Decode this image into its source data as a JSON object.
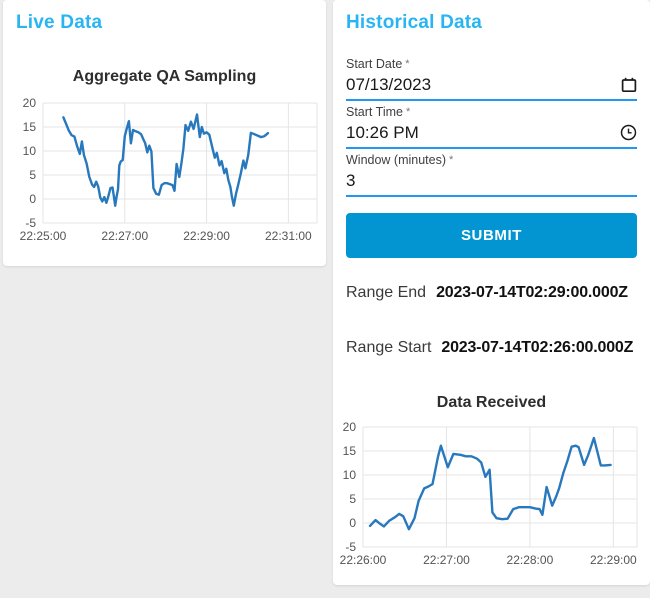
{
  "colors": {
    "header_blue": "#29b5f2",
    "underline_blue": "#2196f3",
    "submit_blue": "#0295d2",
    "page_background": "#ececec"
  },
  "live_panel": {
    "title": "Live Data"
  },
  "historical_panel": {
    "title": "Historical Data",
    "fields": [
      {
        "label": "Start Date",
        "required_marker": "*",
        "value": "07/13/2023",
        "icon": "calendar-icon"
      },
      {
        "label": "Start Time",
        "required_marker": "*",
        "value": "10:26 PM",
        "icon": "clock-icon"
      },
      {
        "label": "Window (minutes)",
        "required_marker": "*",
        "value": "3",
        "icon": ""
      }
    ],
    "submit_label": "SUBMIT",
    "range_end": {
      "label": "Range End",
      "value": "2023-07-14T02:29:00.000Z"
    },
    "range_start": {
      "label": "Range Start",
      "value": "2023-07-14T02:26:00.000Z"
    }
  },
  "chart_data": [
    {
      "type": "line",
      "title": "Aggregate QA Sampling",
      "xlabel": "",
      "ylabel": "",
      "x_unit": "seconds after 22:25:00",
      "x_domain": [
        0,
        402
      ],
      "x_ticks": [
        {
          "v": 0,
          "label": "22:25:00"
        },
        {
          "v": 120,
          "label": "22:27:00"
        },
        {
          "v": 240,
          "label": "22:29:00"
        },
        {
          "v": 360,
          "label": "22:31:00"
        }
      ],
      "y_domain": [
        -5,
        20
      ],
      "y_ticks": [
        -5,
        0,
        5,
        10,
        15,
        20
      ],
      "grid": true,
      "legend": "none",
      "line_color": "#2878bd",
      "grid_color": "#e4e4e4",
      "tick_color": "#545454",
      "points": [
        [
          30,
          17
        ],
        [
          34,
          15.6
        ],
        [
          38,
          14.2
        ],
        [
          42,
          13.3
        ],
        [
          46,
          13
        ],
        [
          50,
          11
        ],
        [
          54,
          9.4
        ],
        [
          57,
          12
        ],
        [
          60,
          9.2
        ],
        [
          64,
          7.4
        ],
        [
          68,
          4.6
        ],
        [
          72,
          3
        ],
        [
          75,
          2.5
        ],
        [
          78,
          3.6
        ],
        [
          81,
          2.6
        ],
        [
          84,
          0.3
        ],
        [
          87,
          -0.5
        ],
        [
          90,
          0.4
        ],
        [
          93,
          -0.8
        ],
        [
          96,
          0.6
        ],
        [
          99,
          2.3
        ],
        [
          102,
          2.4
        ],
        [
          104,
          0.5
        ],
        [
          106,
          -1.4
        ],
        [
          108,
          0.5
        ],
        [
          110,
          2
        ],
        [
          112,
          7
        ],
        [
          114,
          7.8
        ],
        [
          117,
          8.1
        ],
        [
          120,
          13.1
        ],
        [
          123,
          14.7
        ],
        [
          126,
          16.2
        ],
        [
          129,
          11.6
        ],
        [
          132,
          14.4
        ],
        [
          136,
          14.1
        ],
        [
          140,
          13.9
        ],
        [
          144,
          13.5
        ],
        [
          147,
          12.5
        ],
        [
          150,
          11.6
        ],
        [
          153,
          9.7
        ],
        [
          156,
          11.1
        ],
        [
          159,
          9.9
        ],
        [
          162,
          2.3
        ],
        [
          166,
          1.1
        ],
        [
          170,
          0.9
        ],
        [
          174,
          2.9
        ],
        [
          178,
          3.3
        ],
        [
          182,
          3.3
        ],
        [
          186,
          3.1
        ],
        [
          190,
          2.9
        ],
        [
          193,
          1.7
        ],
        [
          196,
          7.3
        ],
        [
          200,
          4.6
        ],
        [
          203,
          7.4
        ],
        [
          206,
          10.5
        ],
        [
          209,
          15.4
        ],
        [
          213,
          14.2
        ],
        [
          217,
          16.1
        ],
        [
          221,
          14.6
        ],
        [
          226,
          17.6
        ],
        [
          230,
          12.9
        ],
        [
          233,
          15
        ],
        [
          236,
          13.6
        ],
        [
          240,
          13.9
        ],
        [
          244,
          13.4
        ],
        [
          248,
          11
        ],
        [
          252,
          8.6
        ],
        [
          255,
          9.6
        ],
        [
          259,
          7
        ],
        [
          262,
          7.9
        ],
        [
          266,
          5.4
        ],
        [
          269,
          6.3
        ],
        [
          272,
          3.9
        ],
        [
          275,
          2.5
        ],
        [
          277,
          0.6
        ],
        [
          280,
          -1.4
        ],
        [
          283,
          1
        ],
        [
          286,
          2.7
        ],
        [
          290,
          5.2
        ],
        [
          294,
          8
        ],
        [
          297,
          6.4
        ],
        [
          301,
          9.1
        ],
        [
          305,
          13.8
        ],
        [
          310,
          13.5
        ],
        [
          315,
          13.2
        ],
        [
          320,
          12.9
        ],
        [
          325,
          13.1
        ],
        [
          330,
          13.7
        ]
      ]
    },
    {
      "type": "line",
      "title": "Data Received",
      "xlabel": "",
      "ylabel": "",
      "x_unit": "seconds after 22:26:00",
      "x_domain": [
        0,
        197
      ],
      "x_ticks": [
        {
          "v": 0,
          "label": "22:26:00"
        },
        {
          "v": 60,
          "label": "22:27:00"
        },
        {
          "v": 120,
          "label": "22:28:00"
        },
        {
          "v": 180,
          "label": "22:29:00"
        }
      ],
      "y_domain": [
        -5,
        20
      ],
      "y_ticks": [
        -5,
        0,
        5,
        10,
        15,
        20
      ],
      "grid": true,
      "legend": "none",
      "line_color": "#2878bd",
      "grid_color": "#e4e4e4",
      "tick_color": "#545454",
      "points": [
        [
          5,
          -0.6
        ],
        [
          9,
          0.6
        ],
        [
          12,
          -0.1
        ],
        [
          15,
          -0.7
        ],
        [
          19,
          0.5
        ],
        [
          23,
          1.2
        ],
        [
          26,
          1.9
        ],
        [
          29,
          1.4
        ],
        [
          33,
          -1.3
        ],
        [
          37,
          1
        ],
        [
          40,
          4.6
        ],
        [
          44,
          7.2
        ],
        [
          47,
          7.6
        ],
        [
          50,
          8.1
        ],
        [
          52,
          11
        ],
        [
          54,
          13.9
        ],
        [
          56,
          16.1
        ],
        [
          61,
          11.6
        ],
        [
          65,
          14.4
        ],
        [
          70,
          14.2
        ],
        [
          74,
          13.9
        ],
        [
          78,
          13.9
        ],
        [
          82,
          13.4
        ],
        [
          85,
          12.6
        ],
        [
          88,
          9.6
        ],
        [
          91,
          11.1
        ],
        [
          93,
          2.2
        ],
        [
          96,
          1
        ],
        [
          100,
          0.8
        ],
        [
          104,
          0.9
        ],
        [
          108,
          2.9
        ],
        [
          112,
          3.3
        ],
        [
          116,
          3.3
        ],
        [
          120,
          3.3
        ],
        [
          124,
          3
        ],
        [
          127,
          2.9
        ],
        [
          129,
          1.7
        ],
        [
          132,
          7.5
        ],
        [
          136,
          3.6
        ],
        [
          139,
          5.6
        ],
        [
          141,
          7.2
        ],
        [
          144,
          10.4
        ],
        [
          147,
          13
        ],
        [
          150,
          15.9
        ],
        [
          153,
          16.1
        ],
        [
          155,
          15.8
        ],
        [
          159,
          12.1
        ],
        [
          162,
          14.2
        ],
        [
          166,
          17.7
        ],
        [
          171,
          12
        ],
        [
          174,
          12
        ],
        [
          178,
          12.1
        ]
      ]
    }
  ]
}
